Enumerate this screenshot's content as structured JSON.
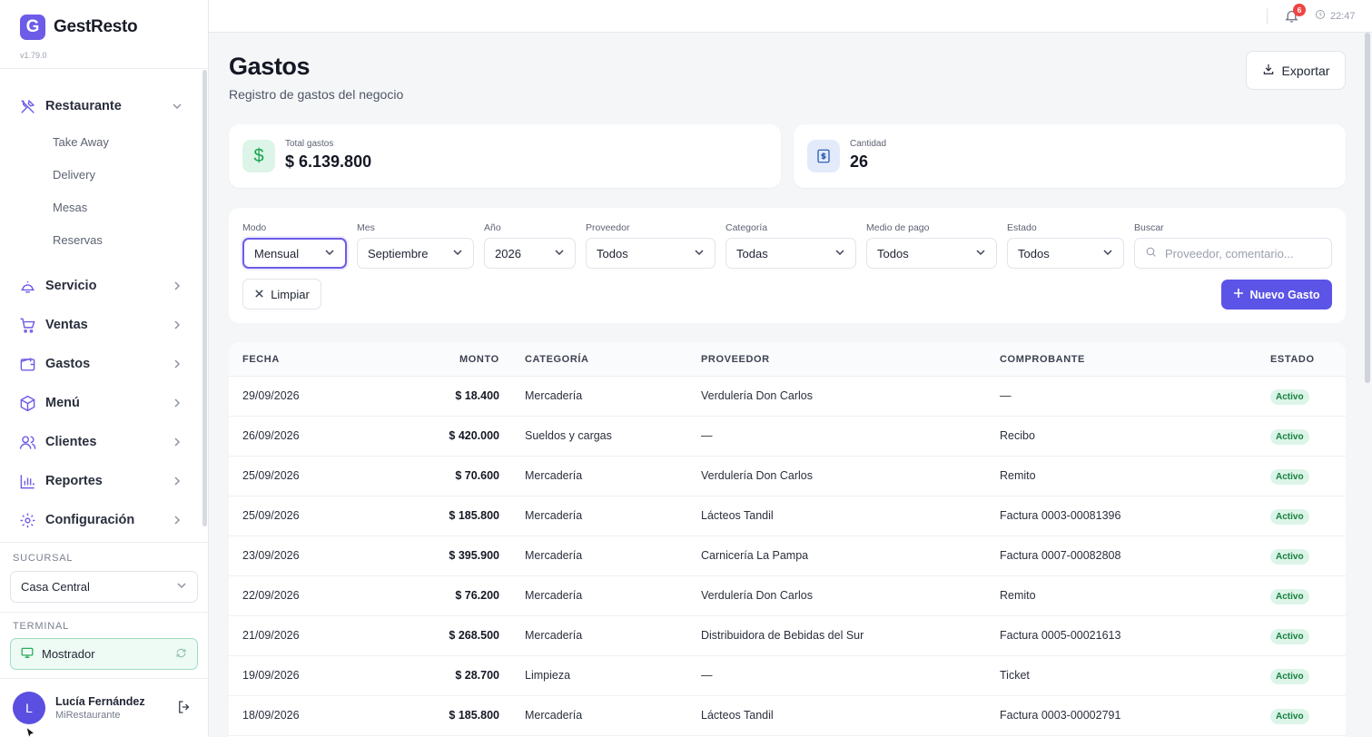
{
  "brand": {
    "logo_letter": "G",
    "name": "GestResto",
    "version": "v1.79.0"
  },
  "nav": {
    "restaurante": {
      "label": "Restaurante",
      "subitems": [
        "Take Away",
        "Delivery",
        "Mesas",
        "Reservas"
      ]
    },
    "items": [
      {
        "label": "Servicio",
        "icon": "service-bell-icon"
      },
      {
        "label": "Ventas",
        "icon": "cart-icon"
      },
      {
        "label": "Gastos",
        "icon": "wallet-icon"
      },
      {
        "label": "Menú",
        "icon": "box-icon"
      },
      {
        "label": "Clientes",
        "icon": "users-icon"
      },
      {
        "label": "Reportes",
        "icon": "bar-chart-icon"
      },
      {
        "label": "Configuración",
        "icon": "gear-icon"
      }
    ]
  },
  "branch": {
    "label": "SUCURSAL",
    "value": "Casa Central"
  },
  "terminal": {
    "label": "TERMINAL",
    "value": "Mostrador"
  },
  "user": {
    "initial": "L",
    "name": "Lucía Fernández",
    "org": "MiRestaurante"
  },
  "topbar": {
    "notifications": "6",
    "time": "22:47"
  },
  "header": {
    "title": "Gastos",
    "subtitle": "Registro de gastos del negocio",
    "export_label": "Exportar"
  },
  "stats": {
    "total": {
      "label": "Total gastos",
      "value": "$ 6.139.800",
      "icon": "dollar-icon"
    },
    "count": {
      "label": "Cantidad",
      "value": "26",
      "icon": "receipt-icon"
    }
  },
  "filters": {
    "modo": {
      "label": "Modo",
      "value": "Mensual"
    },
    "mes": {
      "label": "Mes",
      "value": "Septiembre"
    },
    "anio": {
      "label": "Año",
      "value": "2026"
    },
    "proveedor": {
      "label": "Proveedor",
      "value": "Todos"
    },
    "categoria": {
      "label": "Categoría",
      "value": "Todas"
    },
    "medio": {
      "label": "Medio de pago",
      "value": "Todos"
    },
    "estado": {
      "label": "Estado",
      "value": "Todos"
    },
    "buscar": {
      "label": "Buscar",
      "placeholder": "Proveedor, comentario..."
    },
    "clear_label": "Limpiar",
    "new_label": "Nuevo Gasto"
  },
  "table": {
    "columns": [
      "FECHA",
      "MONTO",
      "CATEGORÍA",
      "PROVEEDOR",
      "COMPROBANTE",
      "ESTADO"
    ],
    "rows": [
      {
        "fecha": "29/09/2026",
        "monto": "$ 18.400",
        "categoria": "Mercadería",
        "proveedor": "Verdulería Don Carlos",
        "comprobante": "—",
        "estado": "Activo"
      },
      {
        "fecha": "26/09/2026",
        "monto": "$ 420.000",
        "categoria": "Sueldos y cargas",
        "proveedor": "—",
        "comprobante": "Recibo",
        "estado": "Activo"
      },
      {
        "fecha": "25/09/2026",
        "monto": "$ 70.600",
        "categoria": "Mercadería",
        "proveedor": "Verdulería Don Carlos",
        "comprobante": "Remito",
        "estado": "Activo"
      },
      {
        "fecha": "25/09/2026",
        "monto": "$ 185.800",
        "categoria": "Mercadería",
        "proveedor": "Lácteos Tandil",
        "comprobante": "Factura 0003-00081396",
        "estado": "Activo"
      },
      {
        "fecha": "23/09/2026",
        "monto": "$ 395.900",
        "categoria": "Mercadería",
        "proveedor": "Carnicería La Pampa",
        "comprobante": "Factura 0007-00082808",
        "estado": "Activo"
      },
      {
        "fecha": "22/09/2026",
        "monto": "$ 76.200",
        "categoria": "Mercadería",
        "proveedor": "Verdulería Don Carlos",
        "comprobante": "Remito",
        "estado": "Activo"
      },
      {
        "fecha": "21/09/2026",
        "monto": "$ 268.500",
        "categoria": "Mercadería",
        "proveedor": "Distribuidora de Bebidas del Sur",
        "comprobante": "Factura 0005-00021613",
        "estado": "Activo"
      },
      {
        "fecha": "19/09/2026",
        "monto": "$ 28.700",
        "categoria": "Limpieza",
        "proveedor": "—",
        "comprobante": "Ticket",
        "estado": "Activo"
      },
      {
        "fecha": "18/09/2026",
        "monto": "$ 185.800",
        "categoria": "Mercadería",
        "proveedor": "Lácteos Tandil",
        "comprobante": "Factura 0003-00002791",
        "estado": "Activo"
      }
    ]
  },
  "colors": {
    "accent": "#6c5ce7",
    "button": "#5b54e6",
    "success_bg": "#dcf5e8",
    "success_text": "#15803d",
    "danger": "#ef4444"
  }
}
